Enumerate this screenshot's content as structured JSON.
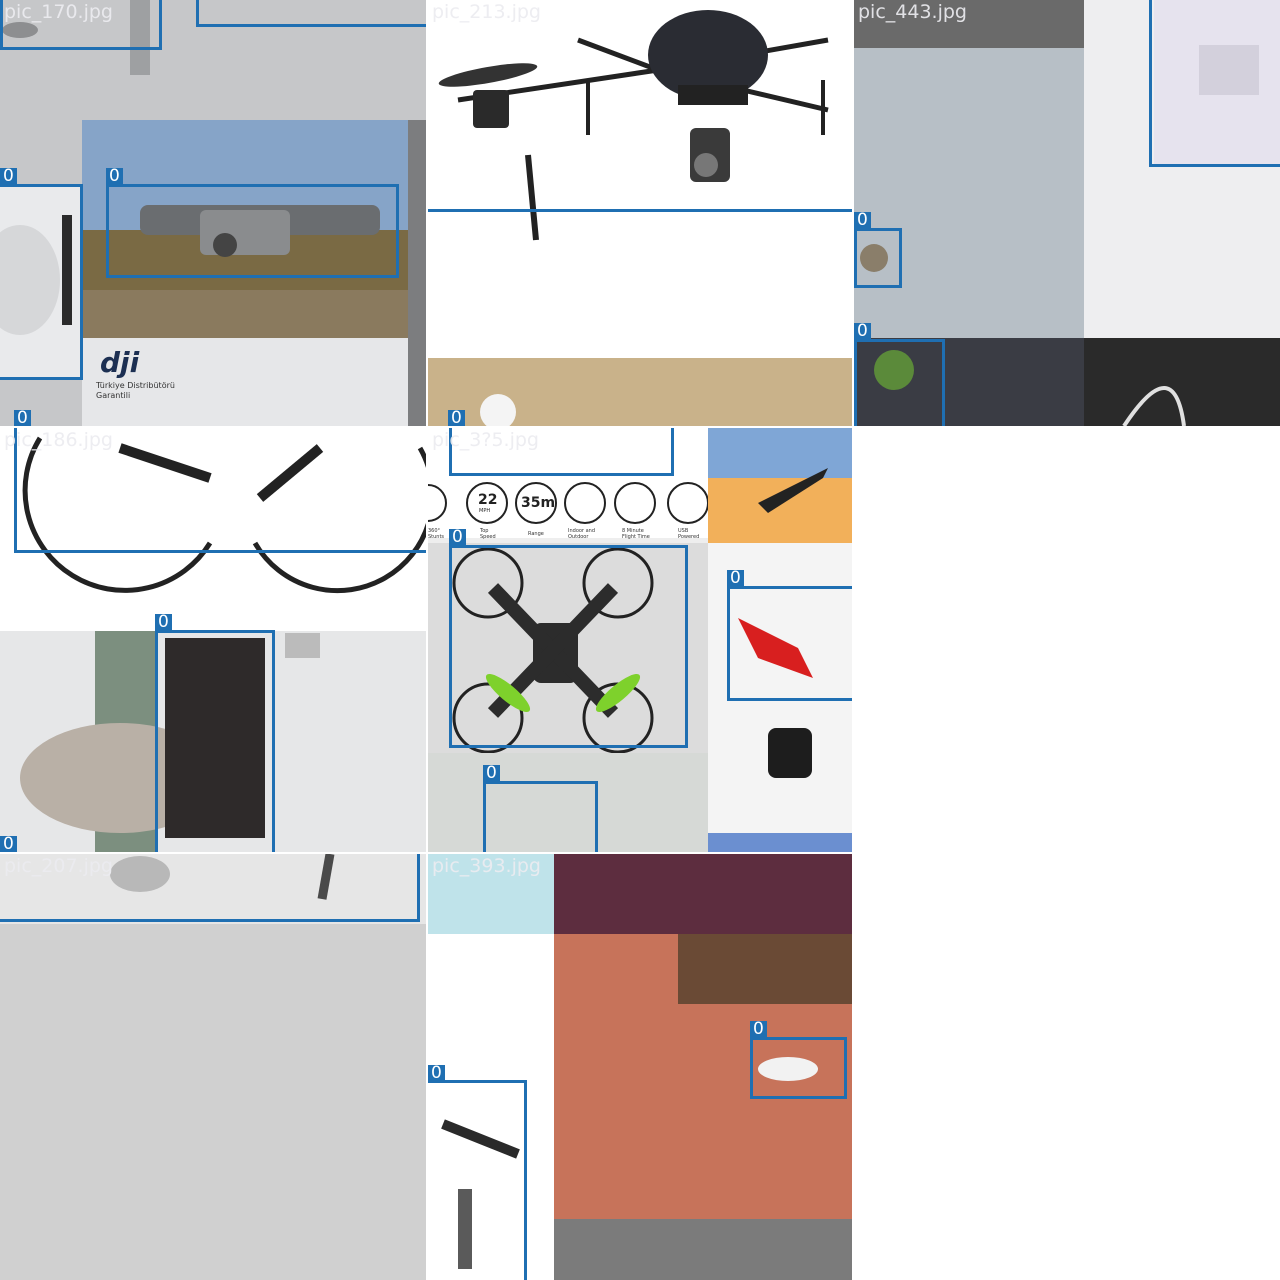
{
  "grid": {
    "tiles": [
      {
        "filename": "pic_170.jpg",
        "labels": [
          "0",
          "0",
          "0"
        ]
      },
      {
        "filename": "pic_213.jpg",
        "labels": [
          "0"
        ]
      },
      {
        "filename": "pic_443.jpg",
        "labels": [
          "0",
          "0"
        ]
      },
      {
        "filename": "pic_186.jpg",
        "labels": [
          "0",
          "0"
        ]
      },
      {
        "filename": "pic_3?5.jpg",
        "labels": [
          "0",
          "0",
          "0"
        ],
        "inset_text": {
          "mph": "22",
          "mph_unit": "MPH",
          "range": "35m",
          "cap1": "360°\nStunts",
          "cap2": "Top\nSpeed",
          "cap3": "Range",
          "cap4": "Indoor and\nOutdoor",
          "cap5": "8 Minute\nFlight Time",
          "cap6": "USB\nPowered"
        }
      },
      {
        "filename": "pic_207.jpg",
        "labels": [
          "0"
        ]
      },
      {
        "filename": "pic_393.jpg",
        "labels": [
          "0",
          "0"
        ]
      }
    ],
    "logo_text": "dji",
    "logo_sub1": "Türkiye Distribütörü",
    "logo_sub2": "Garantili"
  },
  "colors": {
    "box": "#1f6fb2"
  }
}
